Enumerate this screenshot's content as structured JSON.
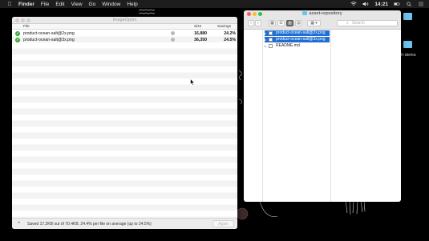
{
  "menubar": {
    "app": "Finder",
    "items": [
      "File",
      "Edit",
      "View",
      "Go",
      "Window",
      "Help"
    ],
    "clock": "14:21"
  },
  "desktop": {
    "label_demo": "h-demo"
  },
  "imageoptim": {
    "title": "ImageOptim",
    "columns": {
      "file": "File",
      "size": "Size",
      "savings": "Savings"
    },
    "rows": [
      {
        "name": "product-ocean-salt@2x.png",
        "size": "16,880",
        "savings": "24.2%"
      },
      {
        "name": "product-ocean-salt@3x.png",
        "size": "36,350",
        "savings": "24.5%"
      }
    ],
    "footer_status": "Saved 17.2KB out of 70.4KB. 24.4% per file on average (up to 24.5%)",
    "again_label": "Again",
    "add_label": "+"
  },
  "finder": {
    "title": "asset-repository",
    "search_placeholder": "Search",
    "items": [
      {
        "name": "product-ocean-salt@2x.png",
        "selected": true
      },
      {
        "name": "product-ocean-salt@3x.png",
        "selected": true
      },
      {
        "name": "README.md",
        "selected": false
      }
    ]
  },
  "colors": {
    "selection": "#1f6ed4",
    "check": "#36a73a",
    "folder": "#6cc3ee"
  }
}
